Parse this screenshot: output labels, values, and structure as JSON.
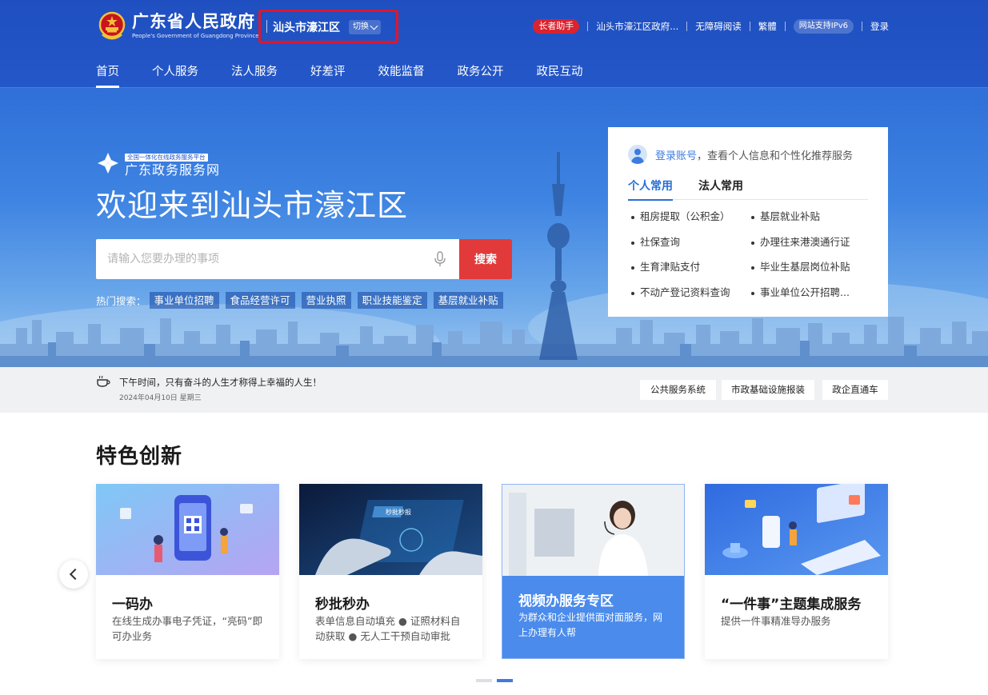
{
  "header": {
    "logo_cn": "广东省人民政府",
    "logo_en": "People's Government of Guangdong Province",
    "region": "汕头市濠江区",
    "region_switch": "切换",
    "util": {
      "elder": "长者助手",
      "local_gov": "汕头市濠江区政府...",
      "accessible": "无障碍阅读",
      "traditional": "繁體",
      "ipv6": "网站支持IPv6",
      "login": "登录"
    },
    "nav": [
      "首页",
      "个人服务",
      "法人服务",
      "好差评",
      "效能监督",
      "政务公开",
      "政民互动"
    ]
  },
  "hero": {
    "platform_tag": "全国一体化在线政务服务平台",
    "platform_name": "广东政务服务网",
    "welcome": "欢迎来到汕头市濠江区",
    "search_placeholder": "请输入您要办理的事项",
    "search_button": "搜索",
    "hot_label": "热门搜索：",
    "hot_tags": [
      "事业单位招聘",
      "食品经营许可",
      "营业执照",
      "职业技能鉴定",
      "基层就业补贴"
    ]
  },
  "login_card": {
    "login_link": "登录账号",
    "login_hint": "，查看个人信息和个性化推荐服务",
    "tabs": [
      "个人常用",
      "法人常用"
    ],
    "items": [
      "租房提取（公积金）",
      "基层就业补贴",
      "社保查询",
      "办理往来港澳通行证",
      "生育津贴支付",
      "毕业生基层岗位补贴",
      "不动产登记资料查询",
      "事业单位公开招聘..."
    ]
  },
  "notice": {
    "message": "下午时间，只有奋斗的人生才称得上幸福的人生！",
    "date": "2024年04月10日 星期三",
    "links": [
      "公共服务系统",
      "市政基础设施报装",
      "政企直通车"
    ]
  },
  "features": {
    "title": "特色创新",
    "cards": [
      {
        "title": "一码办",
        "desc": "在线生成办事电子凭证，“亮码”即可办业务"
      },
      {
        "title": "秒批秒办",
        "desc": "表单信息自动填充 ● 证照材料自动获取 ● 无人工干预自动审批"
      },
      {
        "title": "视频办服务专区",
        "desc": "为群众和企业提供面对面服务，网上办理有人帮"
      },
      {
        "title": "“一件事”主题集成服务",
        "desc": "提供一件事精准导办服务"
      }
    ],
    "image_caption": "秒批秒报"
  },
  "colors": {
    "header_blue": "#2457c8",
    "accent_red": "#e23a3a",
    "region_outline": "#e0162b",
    "link_blue": "#3d7be0",
    "featured_card": "#4a8bec"
  },
  "carousel": {
    "pages": 2,
    "active": 2
  }
}
